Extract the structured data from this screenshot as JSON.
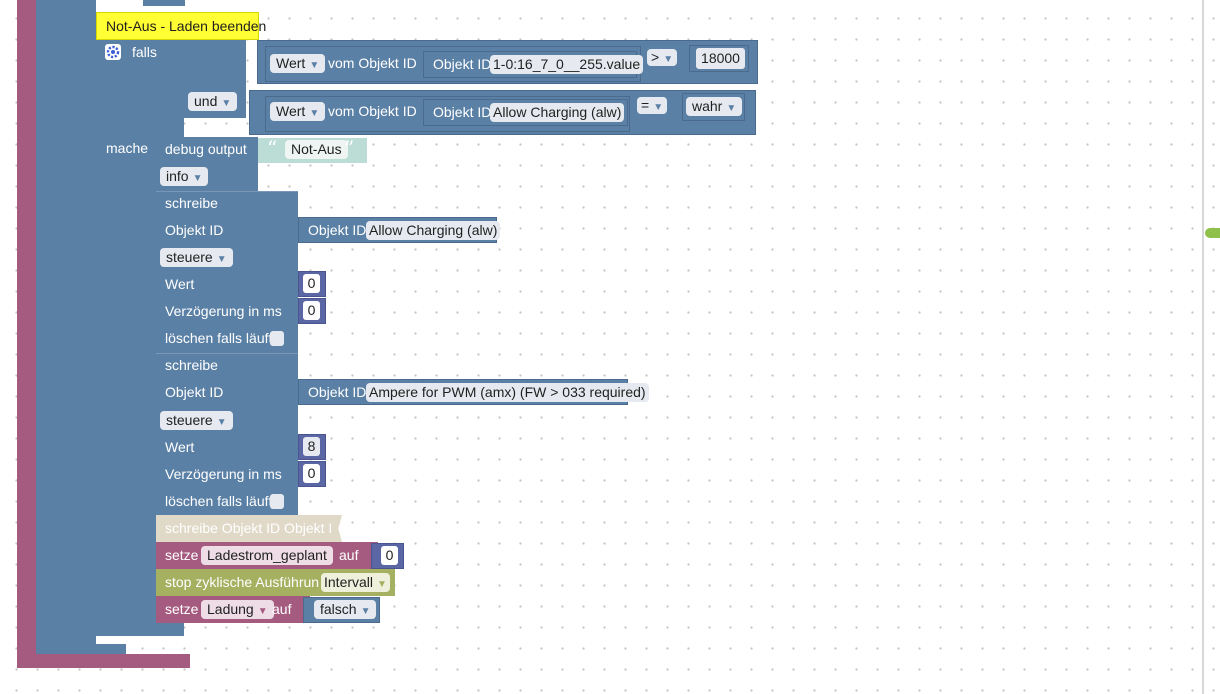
{
  "workspace": {
    "comment": "Not-Aus - Laden beenden",
    "if_label": "falls",
    "do_label": "mache",
    "and_op": "und",
    "cond1": {
      "get_mode": "Wert",
      "from_object": "vom Objekt ID",
      "object_prefix": "Objekt ID",
      "object_name": "1-0:16_7_0__255.value",
      "operator": ">",
      "value": "18000"
    },
    "cond2": {
      "get_mode": "Wert",
      "from_object": "vom Objekt ID",
      "object_prefix": "Objekt ID",
      "object_name": "Allow Charging (alw)",
      "operator": "=",
      "value": "wahr"
    },
    "debug": {
      "label": "debug output",
      "text": "Not-Aus",
      "level": "info"
    },
    "write1": {
      "title": "schreibe",
      "object_label": "Objekt ID",
      "object_prefix": "Objekt ID",
      "object_name": "Allow Charging (alw)",
      "mode": "steuere",
      "value_label": "Wert",
      "value": "0",
      "delay_label": "Verzögerung in ms",
      "delay": "0",
      "clear_label": "löschen falls läuft"
    },
    "write2": {
      "title": "schreibe",
      "object_label": "Objekt ID",
      "object_prefix": "Objekt ID",
      "object_name": "Ampere for PWM (amx) (FW > 033 required)",
      "mode": "steuere",
      "value_label": "Wert",
      "value": "8",
      "delay_label": "Verzögerung in ms",
      "delay": "0",
      "clear_label": "löschen falls läuft"
    },
    "disabled_block": "schreibe Objekt ID Objekt I",
    "set1": {
      "label": "setze",
      "variable": "Ladestrom_geplant",
      "to": "auf",
      "value": "0"
    },
    "stop": {
      "label": "stop zyklische Ausführun",
      "name": "Intervall"
    },
    "set2": {
      "label": "setze",
      "variable": "Ladung",
      "to": "auf",
      "value": "falsch"
    }
  },
  "colors": {
    "logic_blue": "#5b80a5",
    "variable_pink": "#a55b80",
    "timer_green": "#a5b060",
    "text_teal": "#bcdcd6",
    "comment_yellow": "#ffff33",
    "disabled": "#e0d9c8"
  }
}
